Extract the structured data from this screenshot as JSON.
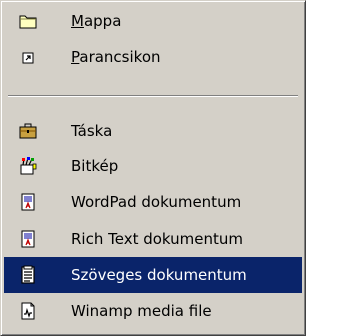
{
  "menu": {
    "items": [
      {
        "label": "Mappa",
        "accel": "M",
        "icon": "folder-icon"
      },
      {
        "label": "Parancsikon",
        "accel": "P",
        "icon": "shortcut-icon"
      },
      {
        "label": "Táska",
        "icon": "briefcase-icon"
      },
      {
        "label": "Bitkép",
        "icon": "bitmap-icon"
      },
      {
        "label": "WordPad dokumentum",
        "icon": "wordpad-doc-icon"
      },
      {
        "label": "Rich Text dokumentum",
        "icon": "rtf-doc-icon"
      },
      {
        "label": "Szöveges dokumentum",
        "icon": "text-doc-icon",
        "selected": true
      },
      {
        "label": "Winamp media file",
        "icon": "winamp-file-icon"
      }
    ]
  },
  "colors": {
    "menu_bg": "#d4d0c8",
    "highlight": "#0a246a",
    "highlight_text": "#ffffff"
  }
}
